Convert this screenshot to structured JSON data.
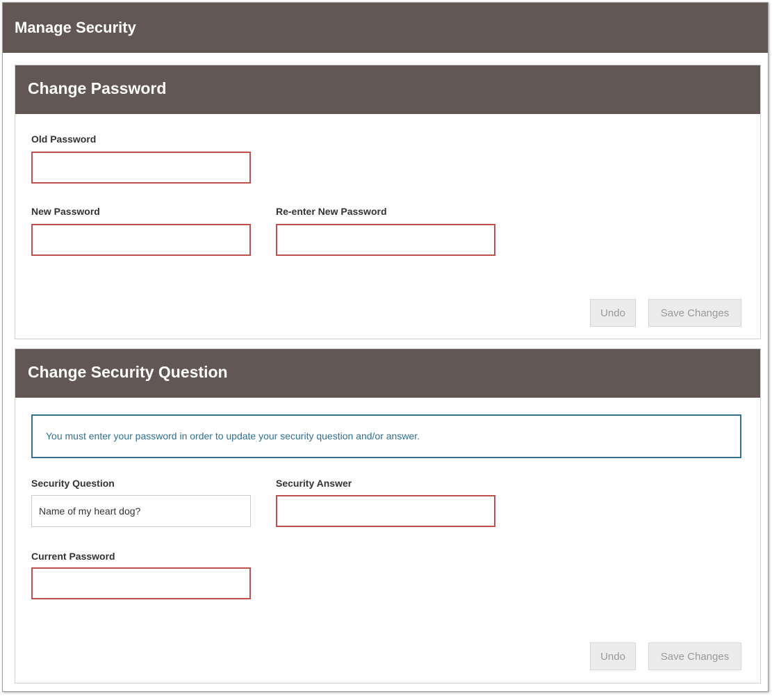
{
  "page": {
    "title": "Manage Security"
  },
  "change_password": {
    "title": "Change Password",
    "old_password": {
      "label": "Old Password",
      "value": ""
    },
    "new_password": {
      "label": "New Password",
      "value": ""
    },
    "reenter_password": {
      "label": "Re-enter New Password",
      "value": ""
    },
    "undo_label": "Undo",
    "save_label": "Save Changes"
  },
  "change_security_question": {
    "title": "Change Security Question",
    "notice": "You must enter your password in order to update your security question and/or answer.",
    "security_question": {
      "label": "Security Question",
      "value": "Name of my heart dog?"
    },
    "security_answer": {
      "label": "Security Answer",
      "value": ""
    },
    "current_password": {
      "label": "Current Password",
      "value": ""
    },
    "undo_label": "Undo",
    "save_label": "Save Changes"
  },
  "colors": {
    "header_bg": "#635756",
    "invalid_border": "#c0504d",
    "info_border": "#31708f"
  }
}
